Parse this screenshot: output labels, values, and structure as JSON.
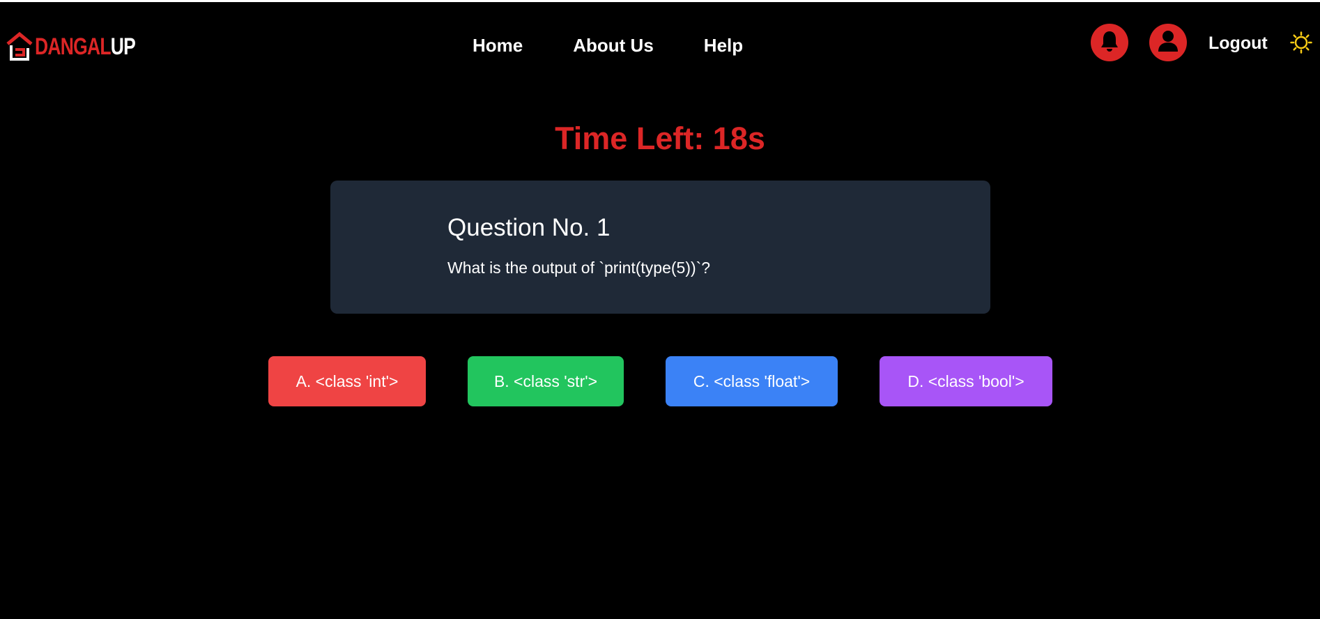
{
  "header": {
    "logo_text_red": "DANGAL",
    "logo_text_white": "UP",
    "nav": [
      {
        "label": "Home"
      },
      {
        "label": "About Us"
      },
      {
        "label": "Help"
      }
    ],
    "notifications_icon": "bell-icon",
    "profile_icon": "user-icon",
    "logout_label": "Logout",
    "theme_icon": "sun-icon"
  },
  "timer": {
    "label": "Time Left: 18s"
  },
  "question": {
    "number_label": "Question No. 1",
    "text": "What is the output of `print(type(5))`?"
  },
  "options": [
    {
      "label": "A. <class 'int'>",
      "color": "#ef4444"
    },
    {
      "label": "B. <class 'str'>",
      "color": "#22c55e"
    },
    {
      "label": "C. <class 'float'>",
      "color": "#3b82f6"
    },
    {
      "label": "D. <class 'bool'>",
      "color": "#a855f7"
    }
  ],
  "colors": {
    "accent_red": "#dc2626",
    "card_bg": "#1f2937",
    "page_bg": "#000000",
    "sun_yellow": "#facc15"
  }
}
